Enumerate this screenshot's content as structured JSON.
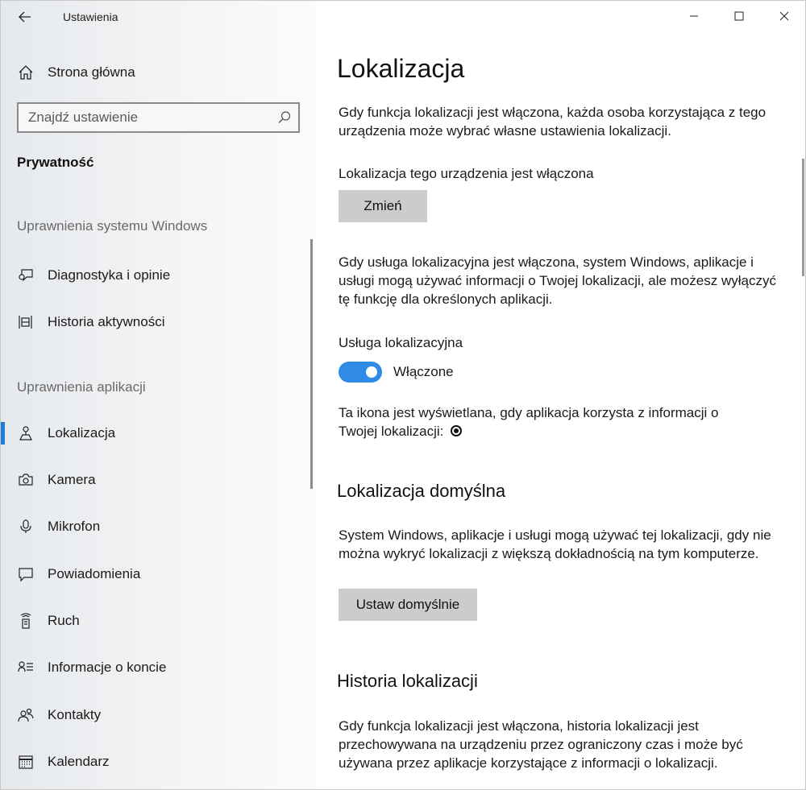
{
  "window": {
    "app_title": "Ustawienia",
    "controls": {
      "minimize_icon": "minimize-icon",
      "maximize_icon": "maximize-icon",
      "close_icon": "close-icon"
    }
  },
  "sidebar": {
    "home_label": "Strona główna",
    "search_placeholder": "Znajdź ustawienie",
    "section_title": "Prywatność",
    "group_windows": "Uprawnienia systemu Windows",
    "windows_items": [
      {
        "label": "Diagnostyka i opinie",
        "icon": "feedback-icon"
      },
      {
        "label": "Historia aktywności",
        "icon": "timeline-icon"
      }
    ],
    "group_apps": "Uprawnienia aplikacji",
    "app_items": [
      {
        "label": "Lokalizacja",
        "icon": "location-icon",
        "selected": true
      },
      {
        "label": "Kamera",
        "icon": "camera-icon"
      },
      {
        "label": "Mikrofon",
        "icon": "microphone-icon"
      },
      {
        "label": "Powiadomienia",
        "icon": "notification-icon"
      },
      {
        "label": "Ruch",
        "icon": "motion-icon"
      },
      {
        "label": "Informacje o koncie",
        "icon": "account-info-icon"
      },
      {
        "label": "Kontakty",
        "icon": "contacts-icon"
      },
      {
        "label": "Kalendarz",
        "icon": "calendar-icon"
      }
    ],
    "accent_color": "#1f7bd6"
  },
  "main": {
    "title": "Lokalizacja",
    "intro": "Gdy funkcja lokalizacji jest włączona, każda osoba korzystająca z tego urządzenia może wybrać własne ustawienia lokalizacji.",
    "device_status": "Lokalizacja tego urządzenia jest włączona",
    "change_button": "Zmień",
    "service_info": "Gdy usługa lokalizacyjna jest włączona, system Windows, aplikacje i usługi mogą używać informacji o Twojej lokalizacji, ale możesz wyłączyć tę funkcję dla określonych aplikacji.",
    "service_label": "Usługa lokalizacyjna",
    "toggle_state": "Włączone",
    "toggle_on": true,
    "toggle_color": "#2f8be6",
    "icon_info_line1": "Ta ikona jest wyświetlana, gdy aplikacja korzysta z informacji o",
    "icon_info_line2": "Twojej lokalizacji:",
    "default_heading": "Lokalizacja domyślna",
    "default_info": "System Windows, aplikacje i usługi mogą używać tej lokalizacji, gdy nie można wykryć lokalizacji z większą dokładnością na tym komputerze.",
    "set_default_button": "Ustaw domyślnie",
    "history_heading": "Historia lokalizacji",
    "history_info": "Gdy funkcja lokalizacji jest włączona, historia lokalizacji jest przechowywana na urządzeniu przez ograniczony czas i może być używana przez aplikacje korzystające z informacji o lokalizacji."
  }
}
